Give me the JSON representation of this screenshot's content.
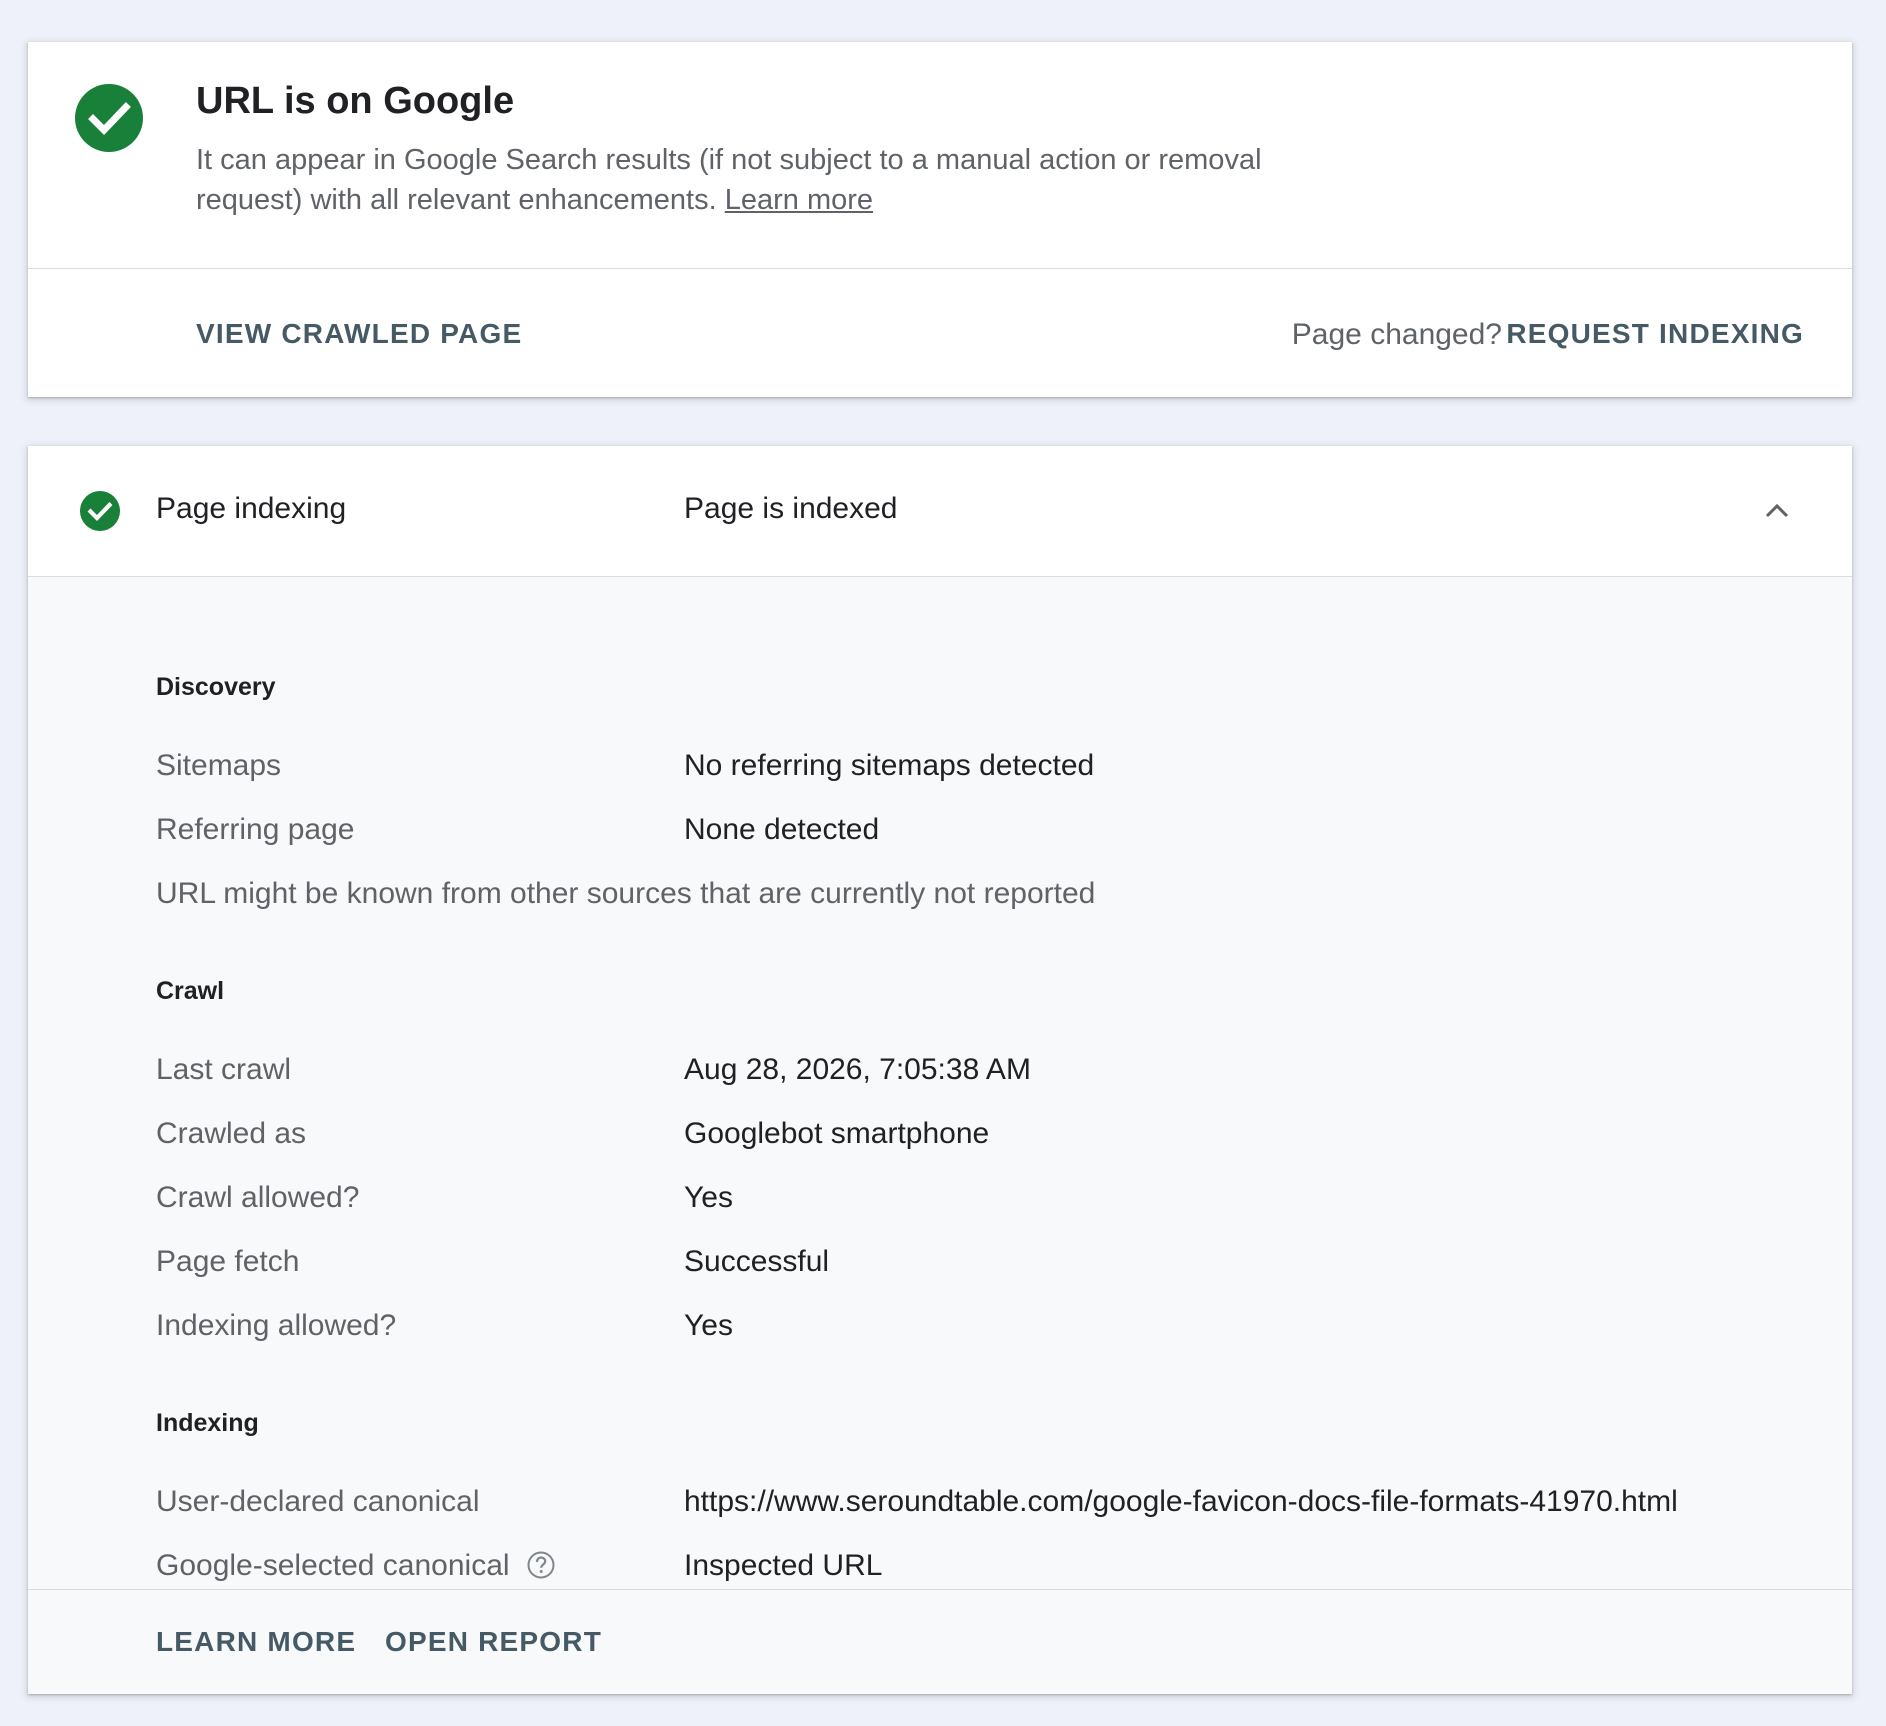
{
  "status": {
    "title": "URL is on Google",
    "description": "It can appear in Google Search results (if not subject to a manual action or removal request) with all relevant enhancements.",
    "learn_more": "Learn more",
    "icon": "check-circle-icon",
    "color": "#188038"
  },
  "actions": {
    "view_crawled": "VIEW CRAWLED PAGE",
    "page_changed": "Page changed?",
    "request_indexing": "REQUEST INDEXING"
  },
  "indexing": {
    "label": "Page indexing",
    "value": "Page is indexed",
    "expanded": true,
    "sections": {
      "discovery": {
        "title": "Discovery",
        "rows": [
          {
            "label": "Sitemaps",
            "value": "No referring sitemaps detected"
          },
          {
            "label": "Referring page",
            "value": "None detected"
          }
        ],
        "note": "URL might be known from other sources that are currently not reported"
      },
      "crawl": {
        "title": "Crawl",
        "rows": [
          {
            "label": "Last crawl",
            "value": "Aug 28, 2026, 7:05:38 AM"
          },
          {
            "label": "Crawled as",
            "value": "Googlebot smartphone"
          },
          {
            "label": "Crawl allowed?",
            "value": "Yes"
          },
          {
            "label": "Page fetch",
            "value": "Successful"
          },
          {
            "label": "Indexing allowed?",
            "value": "Yes"
          }
        ]
      },
      "indexing": {
        "title": "Indexing",
        "rows": [
          {
            "label": "User-declared canonical",
            "value": "https://www.seroundtable.com/google-favicon-docs-file-formats-41970.html"
          },
          {
            "label": "Google-selected canonical",
            "value": "Inspected URL"
          }
        ]
      }
    },
    "footer": {
      "learn_more": "LEARN MORE",
      "open_report": "OPEN REPORT"
    }
  }
}
